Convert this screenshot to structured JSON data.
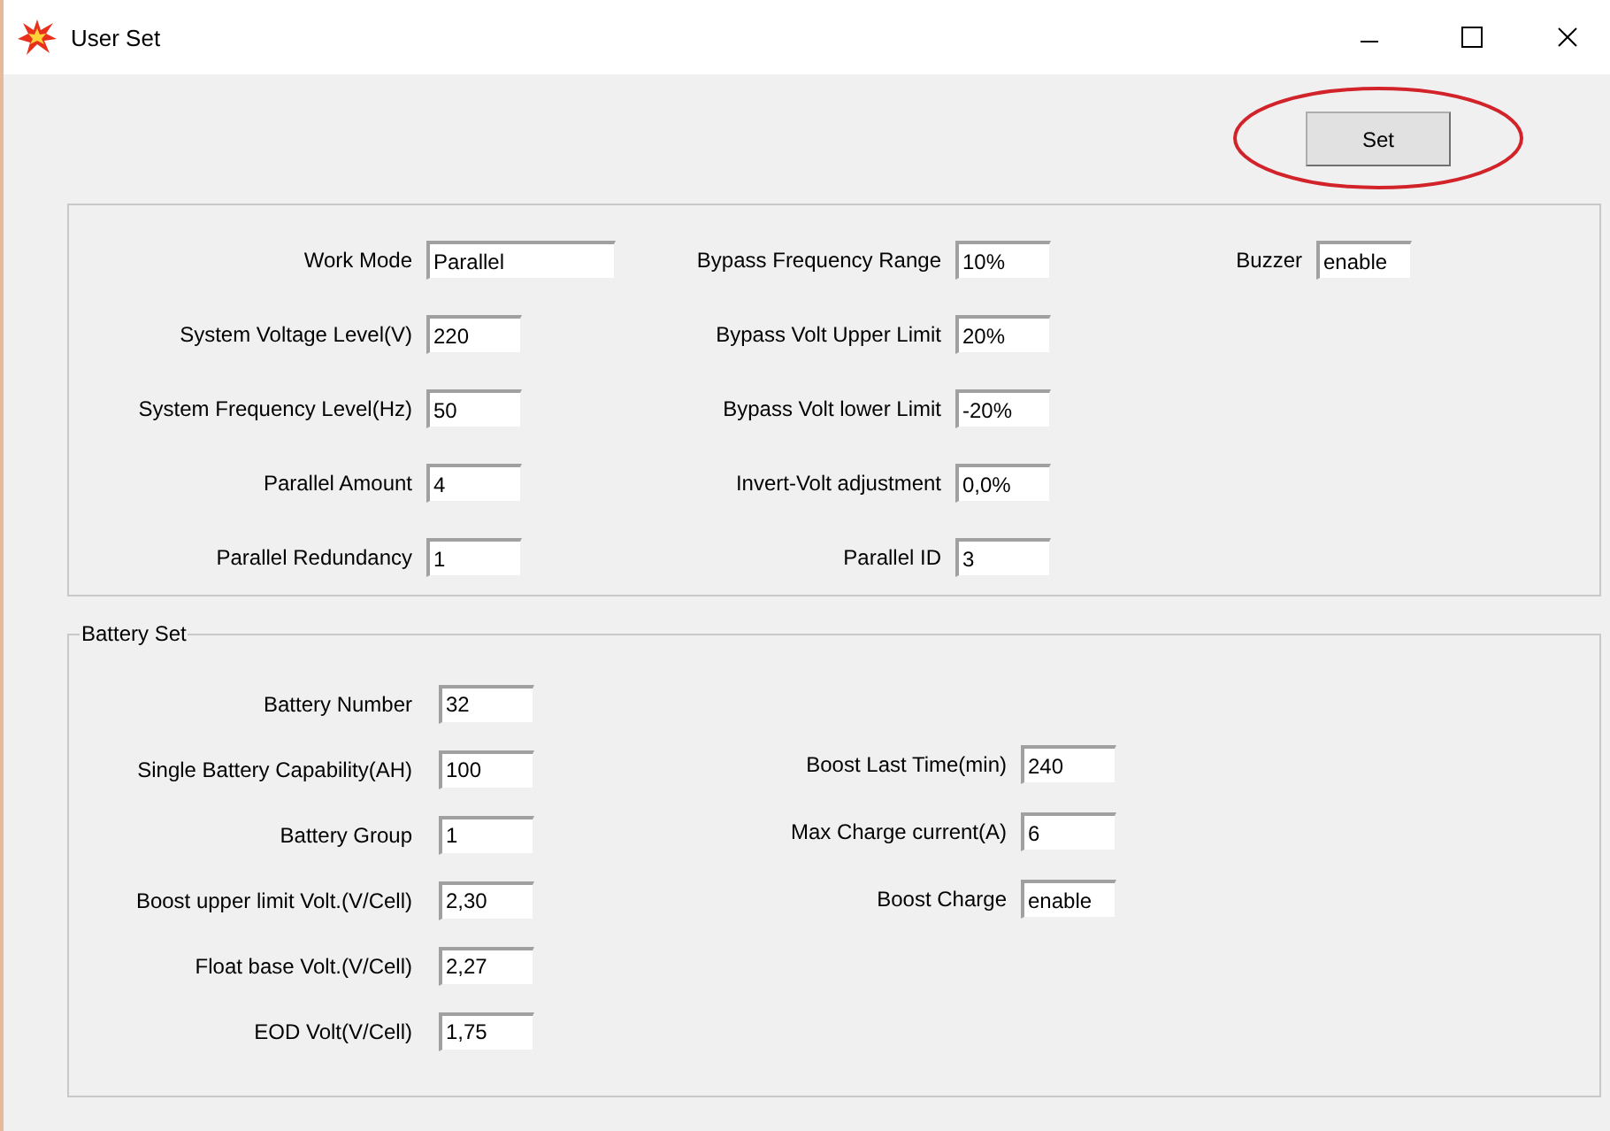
{
  "window": {
    "title": "User Set"
  },
  "set_button": "Set",
  "general": {
    "columns": [
      [
        {
          "label": "Work Mode",
          "value": "Parallel"
        },
        {
          "label": "System Voltage Level(V)",
          "value": "220"
        },
        {
          "label": "System Frequency Level(Hz)",
          "value": "50"
        },
        {
          "label": "Parallel Amount",
          "value": "4"
        },
        {
          "label": "Parallel Redundancy",
          "value": "1"
        }
      ],
      [
        {
          "label": "Bypass Frequency Range",
          "value": "10%"
        },
        {
          "label": "Bypass Volt Upper Limit",
          "value": "20%"
        },
        {
          "label": "Bypass Volt lower Limit",
          "value": "-20%"
        },
        {
          "label": "Invert-Volt adjustment",
          "value": "0,0%"
        },
        {
          "label": "Parallel ID",
          "value": "3"
        }
      ],
      [
        {
          "label": "Buzzer",
          "value": "enable"
        }
      ]
    ]
  },
  "battery": {
    "legend": "Battery Set",
    "columns": [
      [
        {
          "label": "Battery Number",
          "value": "32"
        },
        {
          "label": "Single Battery Capability(AH)",
          "value": "100"
        },
        {
          "label": "Battery Group",
          "value": "1"
        },
        {
          "label": "Boost upper limit Volt.(V/Cell)",
          "value": "2,30"
        },
        {
          "label": "Float base Volt.(V/Cell)",
          "value": "2,27"
        },
        {
          "label": "EOD Volt(V/Cell)",
          "value": "1,75"
        }
      ],
      [
        {
          "label": "Boost Last Time(min)",
          "value": "240"
        },
        {
          "label": "Max Charge current(A)",
          "value": "6"
        },
        {
          "label": "Boost Charge",
          "value": "enable"
        }
      ]
    ]
  }
}
